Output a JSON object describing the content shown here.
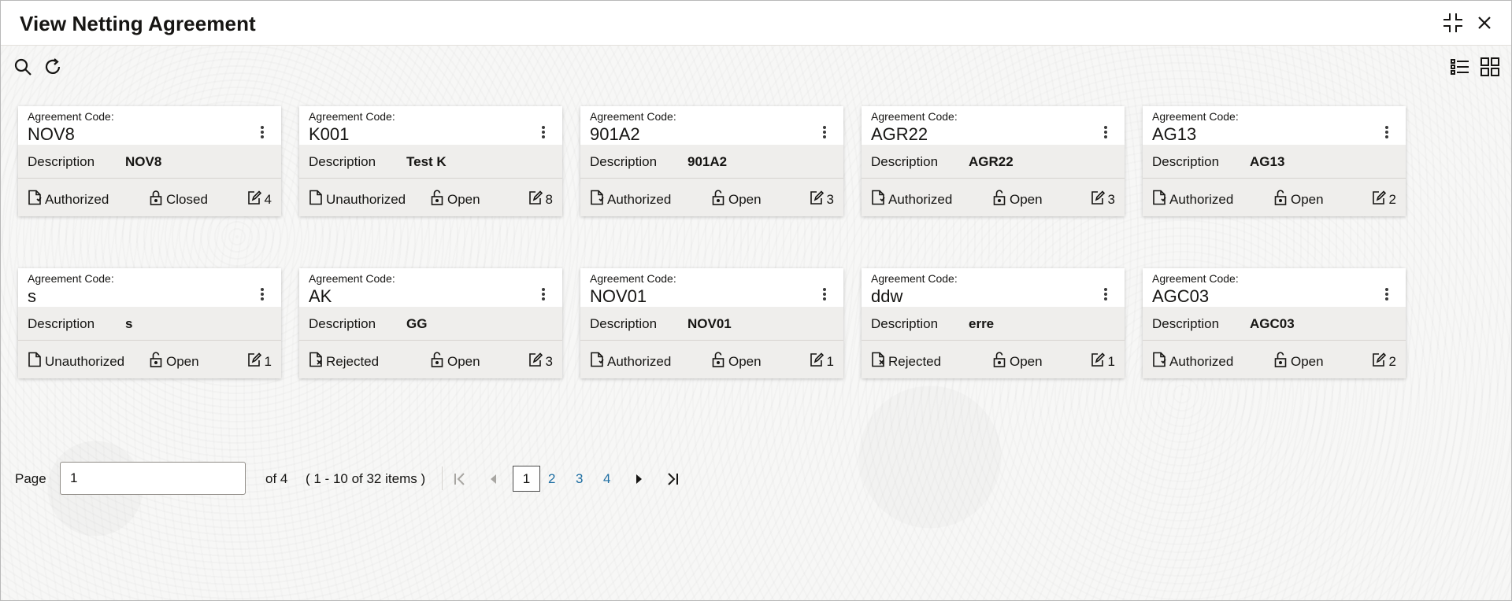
{
  "window": {
    "title": "View Netting Agreement",
    "icons": [
      "minimize-icon",
      "close-icon"
    ]
  },
  "toolbar": {
    "icons": [
      "search-icon",
      "refresh-icon",
      "list-view-icon",
      "tile-view-icon"
    ]
  },
  "card_labels": {
    "code_label": "Agreement Code:",
    "description_label": "Description"
  },
  "cards": [
    {
      "code": "NOV8",
      "description": "NOV8",
      "auth_status": "Authorized",
      "record_status": "Closed",
      "mod_no": "4"
    },
    {
      "code": "K001",
      "description": "Test K",
      "auth_status": "Unauthorized",
      "record_status": "Open",
      "mod_no": "8"
    },
    {
      "code": "901A2",
      "description": "901A2",
      "auth_status": "Authorized",
      "record_status": "Open",
      "mod_no": "3"
    },
    {
      "code": "AGR22",
      "description": "AGR22",
      "auth_status": "Authorized",
      "record_status": "Open",
      "mod_no": "3"
    },
    {
      "code": "AG13",
      "description": "AG13",
      "auth_status": "Authorized",
      "record_status": "Open",
      "mod_no": "2"
    },
    {
      "code": "s",
      "description": "s",
      "auth_status": "Unauthorized",
      "record_status": "Open",
      "mod_no": "1"
    },
    {
      "code": "AK",
      "description": "GG",
      "auth_status": "Rejected",
      "record_status": "Open",
      "mod_no": "3"
    },
    {
      "code": "NOV01",
      "description": "NOV01",
      "auth_status": "Authorized",
      "record_status": "Open",
      "mod_no": "1"
    },
    {
      "code": "ddw",
      "description": "erre",
      "auth_status": "Rejected",
      "record_status": "Open",
      "mod_no": "1"
    },
    {
      "code": "AGC03",
      "description": "AGC03",
      "auth_status": "Authorized",
      "record_status": "Open",
      "mod_no": "2"
    }
  ],
  "pagination": {
    "page_label": "Page",
    "page_value": "1",
    "of_text": "of 4",
    "range_text": "( 1 - 10 of 32 items )",
    "current_page": "1",
    "pages": [
      "2",
      "3",
      "4"
    ],
    "nav_icons": [
      "first-page-icon",
      "previous-page-icon",
      "next-page-icon",
      "last-page-icon"
    ]
  }
}
